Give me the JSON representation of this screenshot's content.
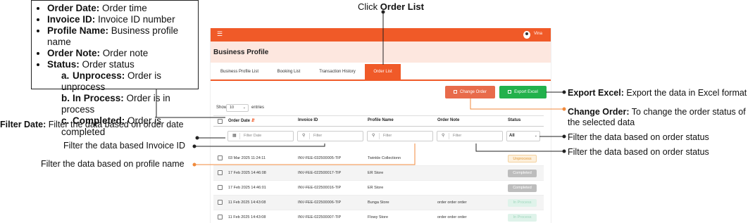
{
  "legend": {
    "items": [
      {
        "term": "Order Date:",
        "desc": " Order time"
      },
      {
        "term": "Invoice ID:",
        "desc": " Invoice ID number"
      },
      {
        "term": "Profile Name:",
        "desc": " Business profile name"
      },
      {
        "term": "Order Note:",
        "desc": " Order note"
      },
      {
        "term": "Status:",
        "desc": " Order status"
      }
    ],
    "sub_items": [
      {
        "marker": "a.",
        "term": "Unprocess:",
        "desc": " Order is unprocess"
      },
      {
        "marker": "b.",
        "term": "In Process:",
        "desc": " Order is in process"
      },
      {
        "marker": "c.",
        "term": "Completed:",
        "desc": " Order is completed"
      }
    ]
  },
  "caption_top": {
    "prefix": "Click ",
    "bold": "Order List"
  },
  "app": {
    "user_name": "Vina",
    "page_title": "Business Profile",
    "tabs": [
      "Business Profile List",
      "Booking List",
      "Transaction History",
      "Order List"
    ],
    "active_tab": "Order List",
    "change_order_label": "Change Order",
    "export_excel_label": "Export Excel",
    "show_label": "Show",
    "entries_value": "10",
    "entries_label": "entries",
    "columns": [
      "Order Date",
      "Invoice ID",
      "Profile Name",
      "Order Note",
      "Status"
    ],
    "filters": {
      "date_placeholder": "Filter Date",
      "invoice_placeholder": "Filter",
      "profile_placeholder": "Filter",
      "note_placeholder": "Filter",
      "status_value": "All"
    },
    "rows": [
      {
        "date": "03 Mar 2025 11:24:11",
        "invoice": "INV-FEE-032500005-TIP",
        "profile": "Twinkle Collectionn",
        "note": "",
        "status": "Unprocess"
      },
      {
        "date": "17 Feb 2025 14:46:08",
        "invoice": "INV-FEE-022500017-TIP",
        "profile": "ER Store",
        "note": "",
        "status": "Completed"
      },
      {
        "date": "17 Feb 2025 14:46:01",
        "invoice": "INV-FEE-022500016-TIP",
        "profile": "ER Store",
        "note": "",
        "status": "Completed"
      },
      {
        "date": "11 Feb 2025 14:43:08",
        "invoice": "INV-FEE-022500006-TIP",
        "profile": "Bunga Store",
        "note": "order order order",
        "status": "In Process"
      },
      {
        "date": "11 Feb 2025 14:43:08",
        "invoice": "INV-FEE-022500007-TIP",
        "profile": "Flowy Store",
        "note": "order order order",
        "status": "In Process"
      }
    ]
  },
  "annotations": {
    "export_excel": {
      "bold": "Export Excel:",
      "text": " Export the data in Excel format"
    },
    "change_order": {
      "bold": "Change Order:",
      "text": " To change the order status of",
      "text2": "the selected data"
    },
    "filter_status_1": "Filter the data based on order status",
    "filter_status_2": "Filter the data based on order status",
    "filter_date": {
      "bold": "Filter Date:",
      "text": " Filter the  data based on order date"
    },
    "filter_invoice": "Filter the data based Invoice ID",
    "filter_profile": "Filter the data based on profile name"
  },
  "colors": {
    "accent": "#f05a28",
    "export_green": "#22b14c",
    "change_orange": "#e86b4b",
    "annotation_orange": "#f08a3c"
  }
}
